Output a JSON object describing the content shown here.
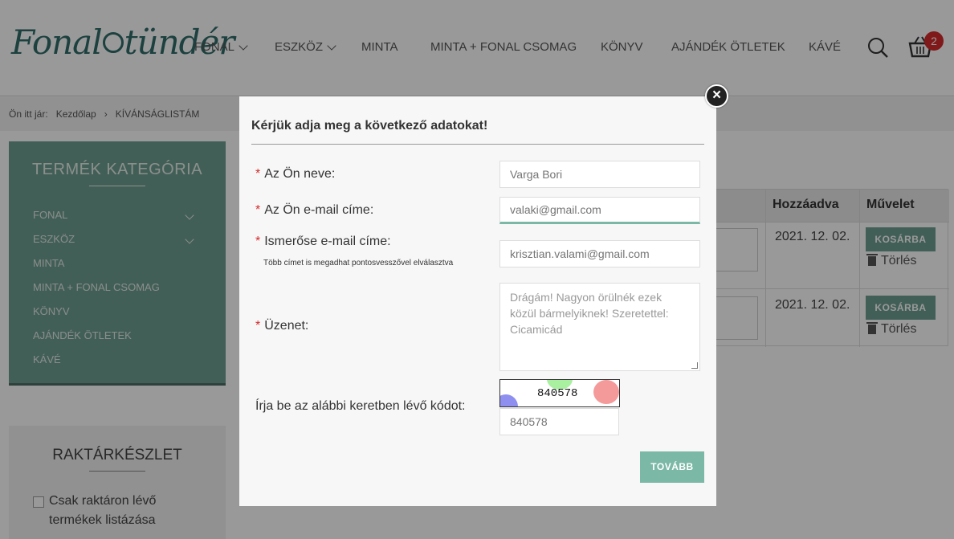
{
  "header": {
    "logo_text": "Fonaltündér",
    "nav": [
      {
        "label": "FONAL",
        "has_dropdown": true
      },
      {
        "label": "ESZKÖZ",
        "has_dropdown": true
      },
      {
        "label": "MINTA",
        "has_dropdown": false
      },
      {
        "label": "MINTA + FONAL CSOMAG",
        "has_dropdown": false
      },
      {
        "label": "KÖNYV",
        "has_dropdown": false
      },
      {
        "label": "AJÁNDÉK ÖTLETEK",
        "has_dropdown": false
      },
      {
        "label": "KÁVÉ",
        "has_dropdown": false
      }
    ],
    "search_icon": "search-icon",
    "cart_icon": "basket-icon",
    "cart_count": "2"
  },
  "breadcrumb": {
    "prefix": "Ön itt jár:",
    "home": "Kezdőlap",
    "separator": "›",
    "current": "KÍVÁNSÁGLISTÁM"
  },
  "sidebar": {
    "category_title": "TERMÉK KATEGÓRIA",
    "categories": [
      {
        "label": "FONAL",
        "expandable": true
      },
      {
        "label": "ESZKÖZ",
        "expandable": true
      },
      {
        "label": "MINTA",
        "expandable": false
      },
      {
        "label": "MINTA + FONAL CSOMAG",
        "expandable": false
      },
      {
        "label": "KÖNYV",
        "expandable": false
      },
      {
        "label": "AJÁNDÉK ÖTLETEK",
        "expandable": false
      },
      {
        "label": "KÁVÉ",
        "expandable": false
      }
    ],
    "stock_title": "RAKTÁRKÉSZLET",
    "stock_filter_label": "Csak raktáron lévő termékek listázása",
    "stock_filter_checked": false
  },
  "wishlist": {
    "columns": [
      "Hozzáadva",
      "Művelet"
    ],
    "rows": [
      {
        "added": "2021. 12. 02.",
        "cart_button": "KOSÁRBA",
        "delete_label": "Törlés"
      },
      {
        "added": "2021. 12. 02.",
        "cart_button": "KOSÁRBA",
        "delete_label": "Törlés"
      }
    ]
  },
  "modal": {
    "title": "Kérjük adja meg a következő adatokat!",
    "close_icon": "close-icon",
    "required_mark": "*",
    "fields": {
      "name": {
        "label": "Az Ön neve:",
        "placeholder": "Varga Bori"
      },
      "email": {
        "label": "Az Ön e-mail címe:",
        "placeholder": "valaki@gmail.com"
      },
      "friend_email": {
        "label": "Ismerőse e-mail címe:",
        "hint": "Több címet is megadhat pontosvesszővel elválasztva",
        "placeholder": "krisztian.valami@gmail.com"
      },
      "message": {
        "label": "Üzenet:",
        "placeholder": "Drágám! Nagyon örülnék ezek közül bármelyiknek! Szeretettel: Cicamicád"
      }
    },
    "captcha": {
      "label": "Írja be az alábbi keretben lévő kódot:",
      "code": "840578",
      "placeholder": "840578"
    },
    "submit_label": "TOVÁBB"
  },
  "colors": {
    "brand": "#2f6d6a",
    "sidebar_bg": "#6f9f92",
    "accent_button": "#7bb8a5",
    "required": "#d62b2b",
    "badge": "#d62b2b"
  }
}
